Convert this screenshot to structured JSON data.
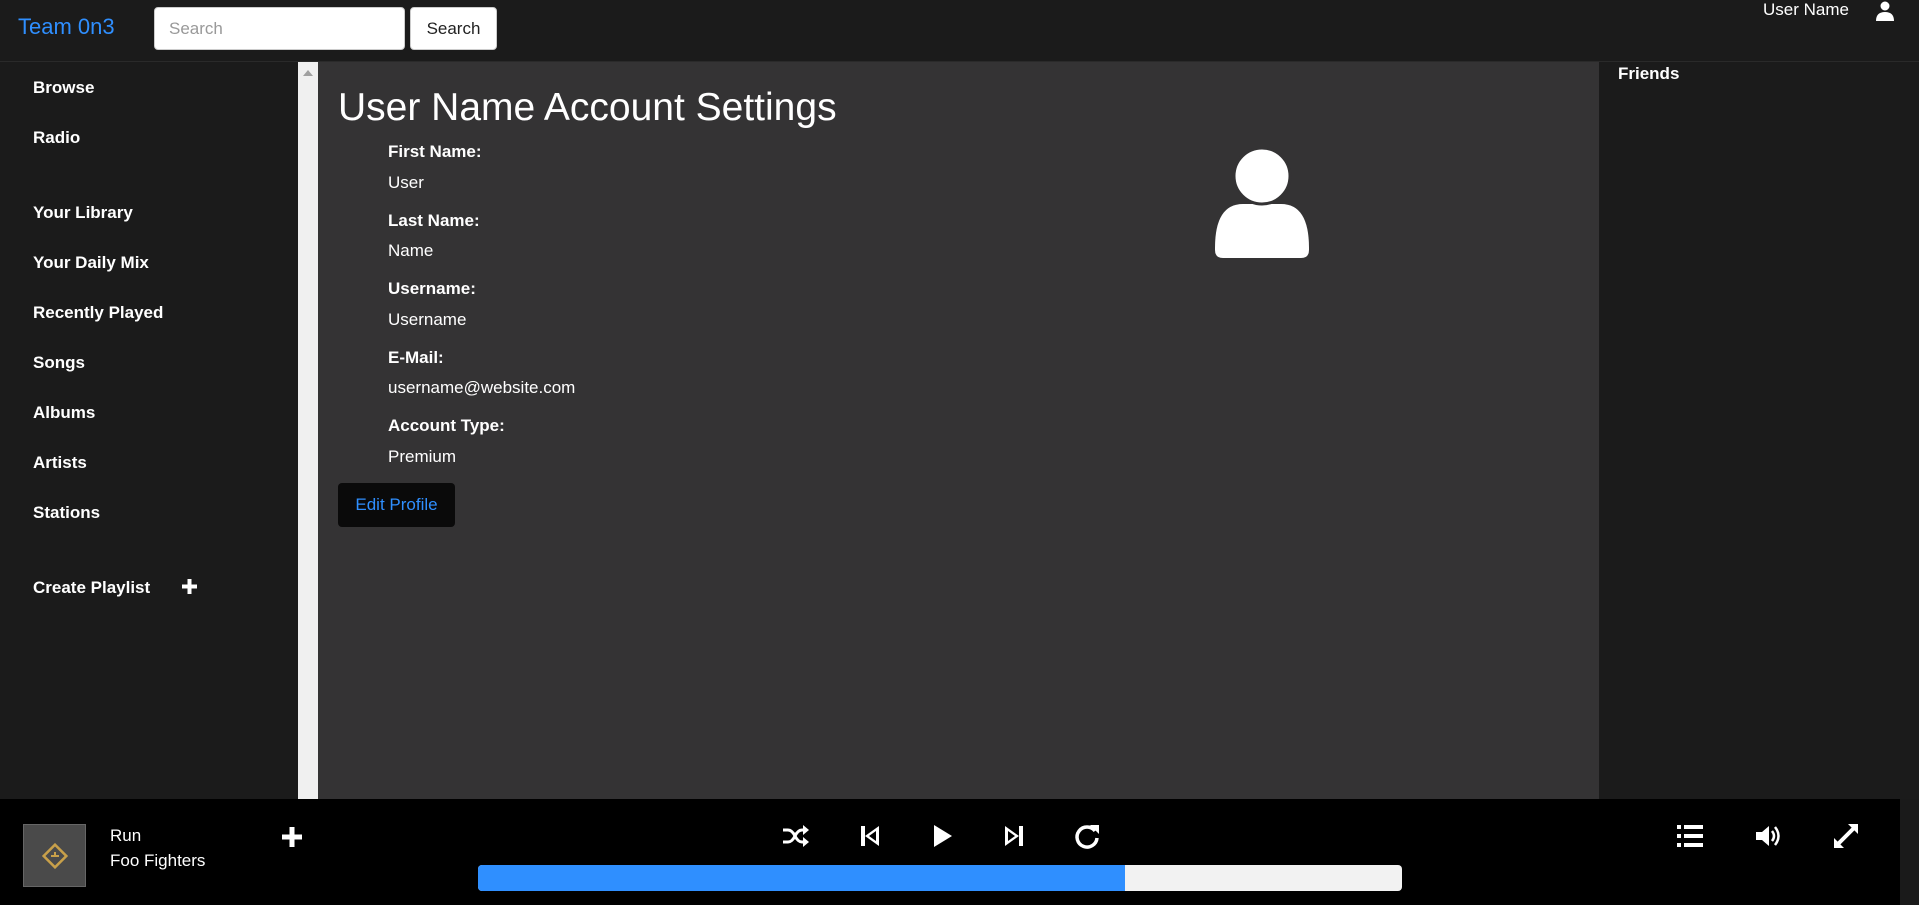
{
  "header": {
    "brand": "Team 0n3",
    "search_placeholder": "Search",
    "search_button": "Search",
    "user_name": "User Name"
  },
  "sidebar": {
    "items": [
      {
        "label": "Browse"
      },
      {
        "label": "Radio"
      },
      {
        "label": "Your Library"
      },
      {
        "label": "Your Daily Mix"
      },
      {
        "label": "Recently Played"
      },
      {
        "label": "Songs"
      },
      {
        "label": "Albums"
      },
      {
        "label": "Artists"
      },
      {
        "label": "Stations"
      }
    ],
    "create_playlist": "Create Playlist"
  },
  "main": {
    "title": "User Name Account Settings",
    "fields": [
      {
        "label": "First Name:",
        "value": "User"
      },
      {
        "label": "Last Name:",
        "value": "Name"
      },
      {
        "label": "Username:",
        "value": "Username"
      },
      {
        "label": "E-Mail:",
        "value": "username@website.com"
      },
      {
        "label": "Account Type:",
        "value": "Premium"
      }
    ],
    "edit_button": "Edit Profile"
  },
  "friends": {
    "title": "Friends"
  },
  "player": {
    "track_title": "Run",
    "track_artist": "Foo Fighters",
    "progress": 0.7,
    "icons": [
      "add-icon",
      "shuffle-icon",
      "previous-icon",
      "play-icon",
      "next-icon",
      "repeat-icon",
      "queue-icon",
      "volume-icon",
      "fullscreen-icon"
    ]
  },
  "colors": {
    "accent": "#2f8fff",
    "main_bg": "#343334",
    "panel_bg": "#1b1b1b",
    "player_bg": "#000000"
  }
}
